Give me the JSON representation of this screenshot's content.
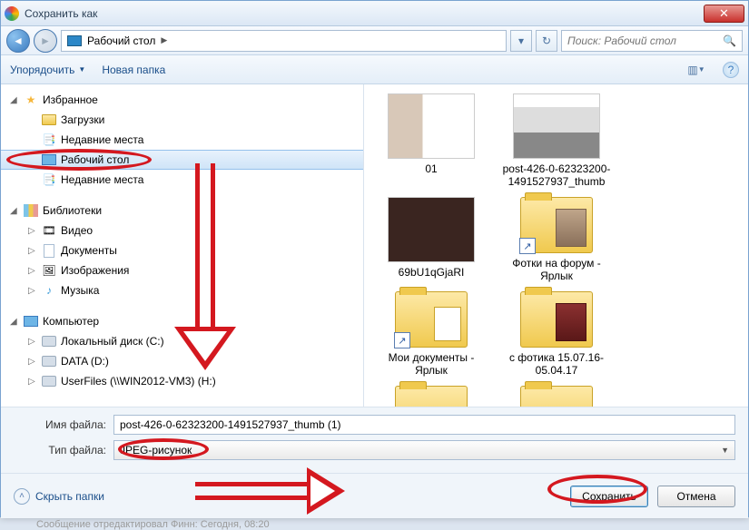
{
  "window": {
    "title": "Сохранить как"
  },
  "nav": {
    "path": "Рабочий стол",
    "arrow": "▶",
    "search_placeholder": "Поиск: Рабочий стол"
  },
  "toolbar": {
    "organize": "Упорядочить",
    "newfolder": "Новая папка"
  },
  "tree": {
    "favorites": "Избранное",
    "downloads": "Загрузки",
    "recent1": "Недавние места",
    "desktop": "Рабочий стол",
    "recent2": "Недавние места",
    "libraries": "Библиотеки",
    "video": "Видео",
    "documents": "Документы",
    "images": "Изображения",
    "music": "Музыка",
    "computer": "Компьютер",
    "localdisk": "Локальный диск (C:)",
    "data": "DATA (D:)",
    "userfiles": "UserFiles (\\\\WIN2012-VM3) (H:)"
  },
  "files": [
    {
      "label": "01"
    },
    {
      "label": "post-426-0-62323200-1491527937_thumb"
    },
    {
      "label": "69bU1qGjaRI"
    },
    {
      "label": "Фотки на форум - Ярлык"
    },
    {
      "label": "Мои документы - Ярлык"
    },
    {
      "label": "с фотика 15.07.16-05.04.17"
    }
  ],
  "fields": {
    "name_label": "Имя файла:",
    "name_value": "post-426-0-62323200-1491527937_thumb (1)",
    "type_label": "Тип файла:",
    "type_value": "JPEG-рисунок"
  },
  "footer": {
    "hide": "Скрыть папки",
    "save": "Сохранить",
    "cancel": "Отмена"
  },
  "status": "Сообщение отредактировал Финн: Сегодня, 08:20"
}
